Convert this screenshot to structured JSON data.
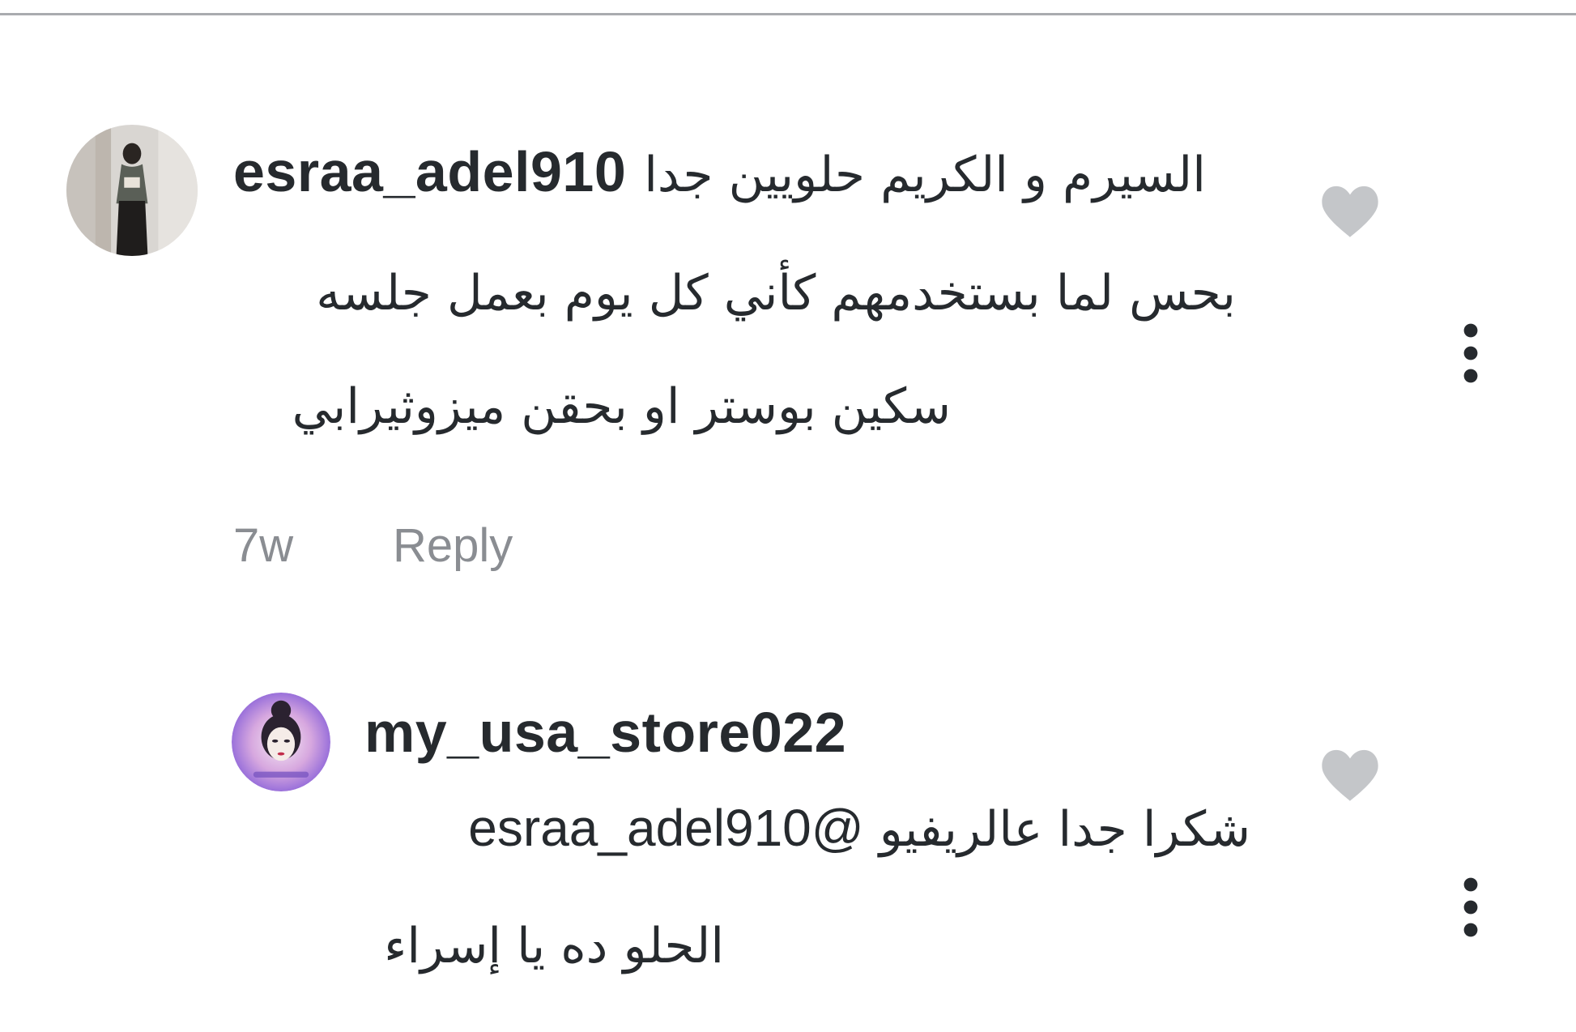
{
  "colors": {
    "text": "#262a2e",
    "meta": "#8a8d92",
    "icon": "#c4c6c9",
    "divider": "#a9abaf",
    "background": "#ffffff"
  },
  "comments": [
    {
      "username": "esraa_adel910",
      "text_lines": [
        "السيرم و الكريم حلويين جدا",
        "بحس لما بستخدمهم  كأني  كل يوم بعمل جلسه",
        "سكين بوستر او بحقن ميزوثيرابي"
      ],
      "time": "7w",
      "reply_label": "Reply",
      "like_icon": "heart-outline-icon",
      "more_icon": "vertical-dots-icon",
      "replies": [
        {
          "username": "my_usa_store022",
          "mention": "@esraa_adel910",
          "text_lines": [
            "شكرا جدا عالريفيو",
            "الحلو ده يا إسراء"
          ],
          "like_icon": "heart-outline-icon",
          "more_icon": "vertical-dots-icon"
        }
      ]
    }
  ]
}
